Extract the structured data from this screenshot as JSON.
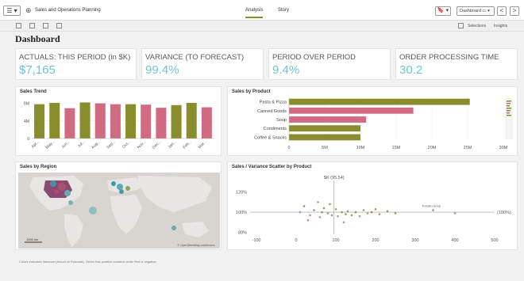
{
  "topbar": {
    "menu_label": "☰ ▾",
    "app_title": "Sales and Operations Planning",
    "tabs": [
      {
        "label": "Analysis"
      },
      {
        "label": "Story"
      }
    ],
    "bookmark_label": "🔖 ▾",
    "sheet_label": "Dashboard ▭ ▾",
    "prev": "<",
    "next": ">"
  },
  "toolbar2": {
    "selections_label": "Selections",
    "insights_label": "Insights"
  },
  "page_title": "Dashboard",
  "kpis": [
    {
      "label": "ACTUALS: THIS PERIOD (in $K)",
      "value": "$7,165"
    },
    {
      "label": "VARIANCE (TO FORECAST)",
      "value": "99.4%"
    },
    {
      "label": "PERIOD OVER PERIOD",
      "value": "9.4%"
    },
    {
      "label": "ORDER PROCESSING TIME",
      "value": "30.2"
    }
  ],
  "panels": {
    "sales_trend": "Sales Trend",
    "sales_by_product": "Sales by Product",
    "sales_by_region": "Sales by Region",
    "scatter": "Sales / Variance Scatter by Product"
  },
  "map": {
    "scale_label": "1000 km",
    "attribution": "© OpenStreetMap contributors"
  },
  "footnote": "Colors indicates Variance (Actual vs Forecast). Green has positive variance while Red is negative.",
  "colors": {
    "olive": "#8a8d2b",
    "pink": "#d06b82",
    "kpi": "#6fc4d4"
  },
  "chart_data": [
    {
      "type": "bar",
      "title": "Sales Trend",
      "categories": [
        "Apr...",
        "May...",
        "Jun...",
        "Jul...",
        "Aug...",
        "Sep...",
        "Oct...",
        "Nov...",
        "Dec...",
        "Jan...",
        "Feb...",
        "Mar..."
      ],
      "values": [
        7.8,
        8.1,
        6.9,
        8.2,
        8.0,
        7.8,
        7.8,
        7.7,
        7.0,
        7.6,
        8.1,
        7.1
      ],
      "variance_positive": [
        true,
        true,
        false,
        true,
        false,
        false,
        true,
        false,
        false,
        true,
        true,
        false
      ],
      "y_ticks": [
        "8M",
        "4M",
        "0"
      ],
      "ylim": [
        0,
        9
      ]
    },
    {
      "type": "bar",
      "orientation": "horizontal",
      "title": "Sales by Product",
      "categories": [
        "Pasta & Pizza",
        "Canned Goods",
        "Soup",
        "Condiments",
        "Coffee & Snacks"
      ],
      "values": [
        25.3,
        17.4,
        10.8,
        10.0,
        10.0
      ],
      "variance_positive": [
        true,
        false,
        false,
        true,
        true
      ],
      "x_ticks": [
        "0",
        "5M",
        "10M",
        "15M",
        "20M",
        "25M",
        "30M"
      ],
      "xlim": [
        0,
        30
      ]
    },
    {
      "type": "scatter",
      "title": "Sales / Variance Scatter by Product",
      "y_ticks": [
        "120%",
        "100%",
        "80%"
      ],
      "x_ticks": [
        "-100",
        "0",
        "100",
        "200",
        "300",
        "400",
        "500"
      ],
      "xlim": [
        -100,
        500
      ],
      "ylim": [
        78,
        130
      ],
      "ref_x_label": "$K (95.54)",
      "ref_x": 95.54,
      "ref_y_label": "(100%)",
      "ref_y": 100,
      "annotation": "Tomato Soup",
      "points": [
        {
          "x": 20,
          "y": 106,
          "pos": true
        },
        {
          "x": 35,
          "y": 97,
          "pos": false
        },
        {
          "x": 45,
          "y": 102,
          "pos": true
        },
        {
          "x": 60,
          "y": 95,
          "pos": false
        },
        {
          "x": 70,
          "y": 104,
          "pos": true
        },
        {
          "x": 80,
          "y": 99,
          "pos": false
        },
        {
          "x": 90,
          "y": 97,
          "pos": true
        },
        {
          "x": 100,
          "y": 103,
          "pos": true
        },
        {
          "x": 105,
          "y": 96,
          "pos": false
        },
        {
          "x": 115,
          "y": 100,
          "pos": true
        },
        {
          "x": 125,
          "y": 98,
          "pos": true
        },
        {
          "x": 130,
          "y": 101,
          "pos": false
        },
        {
          "x": 140,
          "y": 97,
          "pos": true
        },
        {
          "x": 150,
          "y": 100,
          "pos": true
        },
        {
          "x": 160,
          "y": 96,
          "pos": false
        },
        {
          "x": 170,
          "y": 102,
          "pos": true
        },
        {
          "x": 180,
          "y": 99,
          "pos": false
        },
        {
          "x": 190,
          "y": 100,
          "pos": true
        },
        {
          "x": 200,
          "y": 103,
          "pos": true
        },
        {
          "x": 210,
          "y": 98,
          "pos": true
        },
        {
          "x": 230,
          "y": 101,
          "pos": true
        },
        {
          "x": 250,
          "y": 99,
          "pos": true
        },
        {
          "x": 55,
          "y": 110,
          "pos": false
        },
        {
          "x": 30,
          "y": 92,
          "pos": false
        },
        {
          "x": 85,
          "y": 108,
          "pos": true
        },
        {
          "x": 120,
          "y": 90,
          "pos": false
        },
        {
          "x": 345,
          "y": 102,
          "pos": true
        },
        {
          "x": 400,
          "y": 99,
          "pos": false
        },
        {
          "x": 10,
          "y": 100,
          "pos": false
        },
        {
          "x": 65,
          "y": 100,
          "pos": true
        }
      ]
    }
  ]
}
